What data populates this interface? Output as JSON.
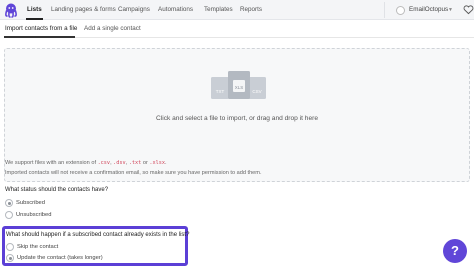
{
  "nav": {
    "items": [
      "Lists",
      "Landing pages & forms",
      "Campaigns",
      "Automations",
      "Templates",
      "Reports"
    ],
    "account_name": "EmailOctopus"
  },
  "subtabs": [
    "Import contacts from a file",
    "Add a single contact"
  ],
  "dropzone": {
    "text": "Click and select a file to import, or drag and drop it here",
    "file_types": [
      "TXT",
      "XLS",
      "CSV"
    ]
  },
  "support": {
    "prefix": "We support files with an extension of",
    "ext1": ".csv",
    "ext2": ".dsv",
    "ext3": ".txt",
    "or": "or",
    "ext4": ".xlsx",
    "period": ".",
    "note": "Imported contacts will not receive a confirmation email, so make sure you have permission to add them."
  },
  "status": {
    "question": "What status should the contacts have?",
    "options": [
      "Subscribed",
      "Unsubscribed"
    ],
    "selected": 0
  },
  "existing": {
    "question": "What should happen if a subscribed contact already exists in the list?",
    "options": [
      "Skip the contact",
      "Update the contact (takes longer)"
    ],
    "selected": 1
  },
  "help_label": "?",
  "colors": {
    "accent": "#5b3fd6",
    "help_button": "#6046d8",
    "code": "#d1455a"
  }
}
